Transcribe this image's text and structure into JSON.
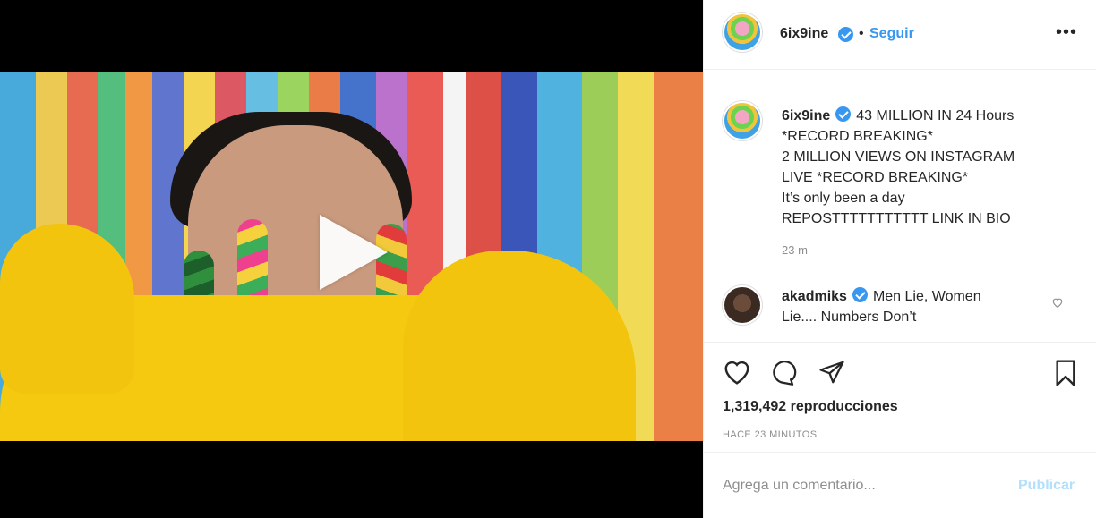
{
  "video": {
    "play_icon": "play-icon"
  },
  "header": {
    "username": "6ix9ine",
    "separator": "•",
    "follow_label": "Seguir",
    "more_icon": "more-options-icon"
  },
  "caption": {
    "username": "6ix9ine",
    "lines": [
      "43 MILLION IN 24 Hours",
      "*RECORD BREAKING*",
      "2 MILLION VIEWS ON INSTAGRAM",
      "LIVE *RECORD BREAKING*",
      "It’s only been a day",
      "REPOSTTTTTTTTTTT LINK IN BIO"
    ],
    "time": "23 m"
  },
  "comment": {
    "username": "akadmiks",
    "lines": [
      "Men Lie, Women",
      "Lie.... Numbers Don’t"
    ]
  },
  "actions": {
    "views": "1,319,492 reproducciones",
    "post_age": "HACE 23 MINUTOS"
  },
  "comment_box": {
    "placeholder": "Agrega un comentario...",
    "publish_label": "Publicar"
  },
  "colors": {
    "accent": "#3897f0",
    "publish_disabled": "#b2dffc",
    "muted": "#8e8e8e"
  }
}
